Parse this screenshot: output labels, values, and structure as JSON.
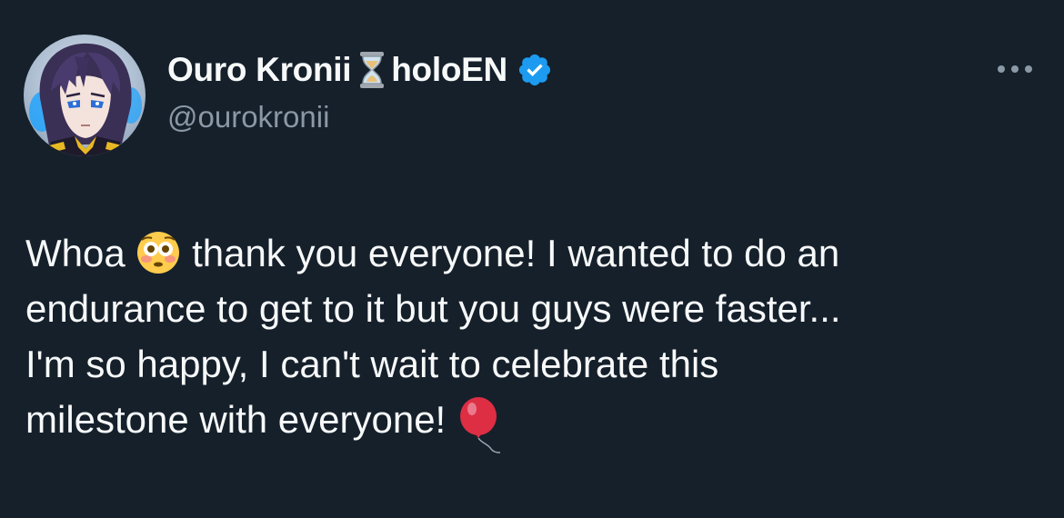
{
  "tweet": {
    "author": {
      "name_part1": "Ouro Kronii",
      "name_part2": "holoEN",
      "handle": "@ourokronii",
      "avatar_icon": "anime-character-avatar",
      "name_emoji_icon": "hourglass-icon",
      "verified_icon": "verified-badge-icon",
      "verified_color": "#1d9bf0"
    },
    "more_icon": "more-options-icon",
    "text_lines": [
      {
        "before": "Whoa",
        "emoji": "flushed-face-emoji",
        "after": "thank you everyone! I wanted to do an"
      },
      {
        "text": "endurance to get to it but you guys were faster..."
      },
      {
        "text": "I'm so happy, I can't wait to celebrate this"
      },
      {
        "before": "milestone with everyone!",
        "emoji": "balloon-emoji"
      }
    ]
  },
  "theme": {
    "background": "#15202b",
    "text": "#f7f9f9",
    "secondary_text": "#8b98a5"
  }
}
